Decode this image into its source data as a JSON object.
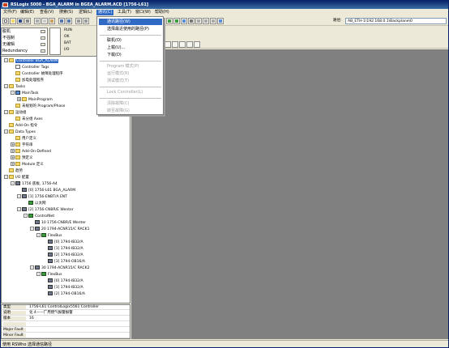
{
  "window": {
    "title": "RSLogix 5000 - BGA_ALARM in BGEA_ALARM.ACD [1756-L61]"
  },
  "menubar": {
    "items": [
      "文件(F)",
      "编辑(E)",
      "查看(V)",
      "搜索(S)",
      "逻辑(L)",
      "通讯(C)",
      "工具(T)",
      "窗口(W)",
      "帮助(H)"
    ]
  },
  "toolbar": {
    "path_label": "路径:",
    "path_value": "AB_ETH-1\\192.168.0.1\\Backplane\\0"
  },
  "status_panel": {
    "rows": [
      "脱机",
      "不强制",
      "无编辑",
      "Redundancy"
    ],
    "io_labels": [
      "RUN",
      "OK",
      "BAT",
      "I/O"
    ]
  },
  "dropdown": {
    "items": [
      {
        "label": "通讯路径(W)",
        "state": "highlight"
      },
      {
        "label": "选择最近使用的路径(P)",
        "state": "normal"
      },
      {
        "label": "",
        "state": "sep"
      },
      {
        "label": "联机(O)",
        "state": "normal"
      },
      {
        "label": "上载(U)...",
        "state": "normal"
      },
      {
        "label": "下载(D)",
        "state": "normal"
      },
      {
        "label": "",
        "state": "sep"
      },
      {
        "label": "Program 模式(P)",
        "state": "disabled"
      },
      {
        "label": "运行模式(R)",
        "state": "disabled"
      },
      {
        "label": "测试模式(T)",
        "state": "disabled"
      },
      {
        "label": "",
        "state": "sep"
      },
      {
        "label": "Lock Controller(L)",
        "state": "disabled"
      },
      {
        "label": "",
        "state": "sep"
      },
      {
        "label": "清除故障(C)",
        "state": "disabled"
      },
      {
        "label": "转至故障(G)",
        "state": "disabled"
      }
    ]
  },
  "tree": {
    "items": [
      {
        "label": "Controller BGA_ALARM",
        "level": 0,
        "icon": "folder",
        "exp": "-",
        "selected": true
      },
      {
        "label": "Controller Tags",
        "level": 1,
        "icon": "doc",
        "exp": ""
      },
      {
        "label": "Controller 故障处理程序",
        "level": 1,
        "icon": "folder",
        "exp": ""
      },
      {
        "label": "加电处理程序",
        "level": 1,
        "icon": "folder",
        "exp": ""
      },
      {
        "label": "Tasks",
        "level": 0,
        "icon": "folder",
        "exp": "-"
      },
      {
        "label": "MainTask",
        "level": 1,
        "icon": "task",
        "exp": "-"
      },
      {
        "label": "MainProgram",
        "level": 2,
        "icon": "folder",
        "exp": "+"
      },
      {
        "label": "未规划的 Program/Phase",
        "level": 1,
        "icon": "folder",
        "exp": ""
      },
      {
        "label": "运动组",
        "level": 0,
        "icon": "folder",
        "exp": "-"
      },
      {
        "label": "未分组 Axes",
        "level": 1,
        "icon": "folder",
        "exp": ""
      },
      {
        "label": "Add-On 指令",
        "level": 0,
        "icon": "folder",
        "exp": ""
      },
      {
        "label": "Data Types",
        "level": 0,
        "icon": "folder",
        "exp": "-"
      },
      {
        "label": "用户定义",
        "level": 1,
        "icon": "folder",
        "exp": ""
      },
      {
        "label": "字符串",
        "level": 1,
        "icon": "folder",
        "exp": "+"
      },
      {
        "label": "Add-On-Defined",
        "level": 1,
        "icon": "folder",
        "exp": "+"
      },
      {
        "label": "预定义",
        "level": 1,
        "icon": "folder",
        "exp": "+"
      },
      {
        "label": "Module 定义",
        "level": 1,
        "icon": "folder",
        "exp": "+"
      },
      {
        "label": "趋势",
        "level": 0,
        "icon": "folder",
        "exp": ""
      },
      {
        "label": "I/O 配置",
        "level": 0,
        "icon": "folder",
        "exp": "-"
      },
      {
        "label": "1756 底板, 1756-A4",
        "level": 1,
        "icon": "mod",
        "exp": "-"
      },
      {
        "label": "[0] 1756-L61 BGA_ALARM",
        "level": 2,
        "icon": "mod",
        "exp": ""
      },
      {
        "label": "[1] 1756-ENBT/A ENT",
        "level": 2,
        "icon": "mod",
        "exp": "-"
      },
      {
        "label": "以太网",
        "level": 3,
        "icon": "net",
        "exp": ""
      },
      {
        "label": "[2] 1756-CNBR/E Wenter",
        "level": 2,
        "icon": "mod",
        "exp": "-"
      },
      {
        "label": "ControlNet",
        "level": 3,
        "icon": "net",
        "exp": "-"
      },
      {
        "label": "10 1756-CNBR/E Wenter",
        "level": 4,
        "icon": "mod",
        "exp": ""
      },
      {
        "label": "20 1794-ACNR15/C RACK1",
        "level": 4,
        "icon": "mod",
        "exp": "-"
      },
      {
        "label": "FlexBus",
        "level": 5,
        "icon": "net",
        "exp": "-"
      },
      {
        "label": "[0] 1794-IB32/A",
        "level": 6,
        "icon": "mod",
        "exp": ""
      },
      {
        "label": "[1] 1794-IB32/A",
        "level": 6,
        "icon": "mod",
        "exp": ""
      },
      {
        "label": "[2] 1794-IB32/A",
        "level": 6,
        "icon": "mod",
        "exp": ""
      },
      {
        "label": "[3] 1794-OB16/A",
        "level": 6,
        "icon": "mod",
        "exp": ""
      },
      {
        "label": "30 1794-ACNR15/C RACK2",
        "level": 4,
        "icon": "mod",
        "exp": "-"
      },
      {
        "label": "FlexBus",
        "level": 5,
        "icon": "net",
        "exp": "-"
      },
      {
        "label": "[0] 1794-IB32/A",
        "level": 6,
        "icon": "mod",
        "exp": ""
      },
      {
        "label": "[1] 1794-IB32/A",
        "level": 6,
        "icon": "mod",
        "exp": ""
      },
      {
        "label": "[2] 1794-OB16/A",
        "level": 6,
        "icon": "mod",
        "exp": ""
      }
    ]
  },
  "info_panel": {
    "rows": [
      {
        "k": "类型",
        "v": "1756-L61 ControlLogix5561 Controller"
      },
      {
        "k": "说明",
        "v": "化 4——厂用燃气报警报警"
      },
      {
        "k": "版本",
        "v": "16"
      },
      {
        "k": "",
        "v": ""
      },
      {
        "k": "Major Fault",
        "v": ""
      },
      {
        "k": "Minor Fault",
        "v": ""
      }
    ]
  },
  "statusbar": {
    "text": "使用 RSWho 选择通信路径"
  },
  "colors": {
    "title_gradient_start": "#0a246a",
    "title_gradient_end": "#3a6ea5",
    "selection": "#316ac5",
    "workspace": "#808080"
  }
}
